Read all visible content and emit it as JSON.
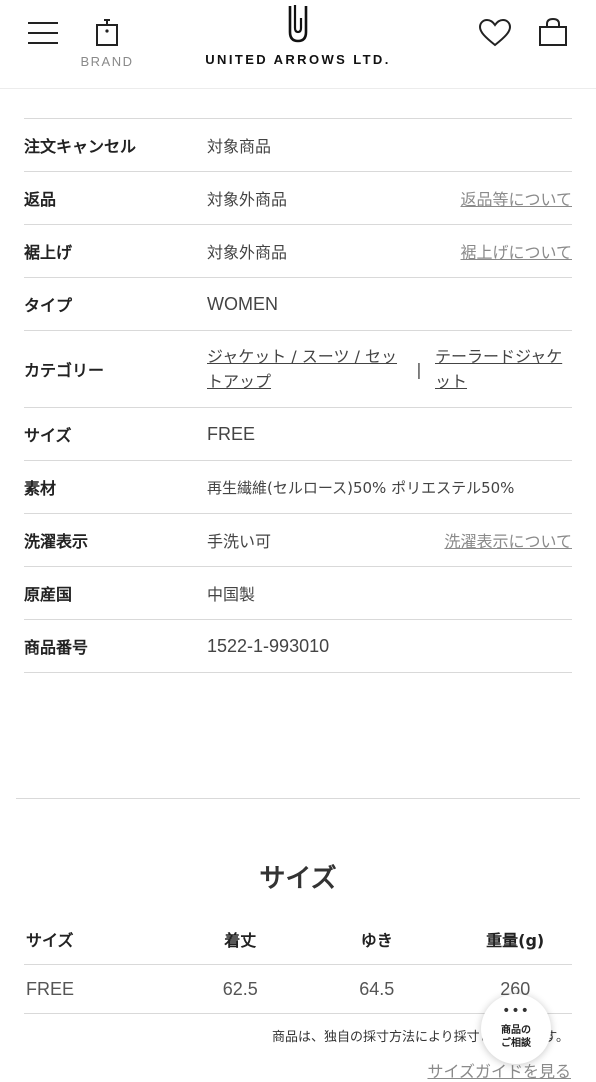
{
  "header": {
    "brand_label": "BRAND",
    "logo_text": "UNITED ARROWS LTD."
  },
  "icons": {
    "menu": "hamburger-menu-icon",
    "brand": "brand-tag-icon",
    "logo": "united-arrows-logo-mark",
    "favorite": "heart-icon",
    "cart": "shopping-bag-icon",
    "consult": "more-dots-icon"
  },
  "spec": {
    "cancel": {
      "label": "注文キャンセル",
      "value": "対象商品"
    },
    "returns": {
      "label": "返品",
      "value": "対象外商品",
      "link": "返品等について"
    },
    "hem": {
      "label": "裾上げ",
      "value": "対象外商品",
      "link": "裾上げについて"
    },
    "type": {
      "label": "タイプ",
      "value": "WOMEN"
    },
    "category": {
      "label": "カテゴリー",
      "link1": "ジャケット / スーツ / セットアップ",
      "separator": "|",
      "link2": "テーラードジャケット"
    },
    "size": {
      "label": "サイズ",
      "value": "FREE"
    },
    "material": {
      "label": "素材",
      "value": "再生繊維(セルロース)50% ポリエステル50%"
    },
    "care": {
      "label": "洗濯表示",
      "value": "手洗い可",
      "link": "洗濯表示について"
    },
    "origin": {
      "label": "原産国",
      "value": "中国製"
    },
    "product_no": {
      "label": "商品番号",
      "value": "1522-1-993010"
    }
  },
  "size_section": {
    "title": "サイズ",
    "headers": [
      "サイズ",
      "着丈",
      "ゆき",
      "重量(g)"
    ],
    "rows": [
      [
        "FREE",
        "62.5",
        "64.5",
        "260"
      ]
    ],
    "note": "商品は、独自の採寸方法により採寸されています。",
    "guide_link": "サイズガイドを見る"
  },
  "consult": {
    "dots": "•••",
    "line1": "商品の",
    "line2": "ご相談"
  },
  "colors": {
    "text": "#333333",
    "link_gray": "#8a8a8a",
    "divider": "#d9d9d9",
    "background": "#ffffff"
  }
}
